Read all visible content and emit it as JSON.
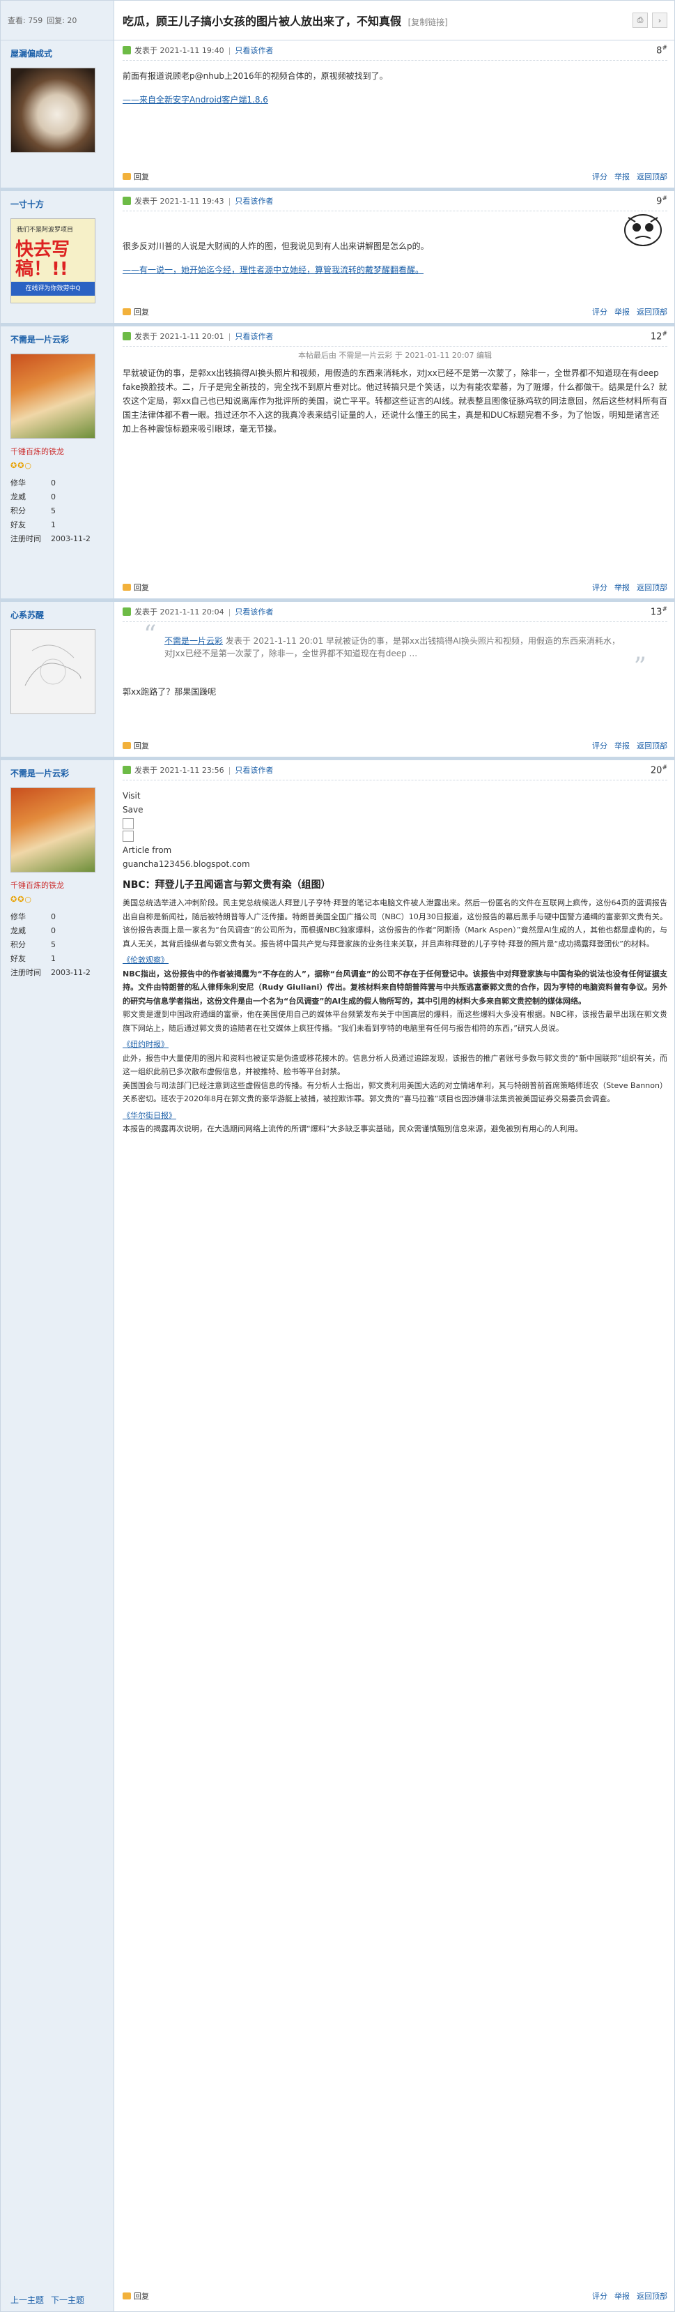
{
  "header": {
    "views_label": "查看: 759",
    "replies_label": "回复: 20",
    "title": "吃瓜，顾王儿子搞小女孩的图片被人放出来了，不知真假",
    "copy_link": "[复制链接]"
  },
  "posts": [
    {
      "username": "屋漏偏成式",
      "posted": "发表于 2021-1-11 19:40",
      "filter": "只看该作者",
      "floor": "8",
      "body": "前面有报道说顾老p@nhub上2016年的视频合体的，原视频被找到了。",
      "link": "——来自全新安字Android客户端1.8.6",
      "reply": "回复",
      "actions": [
        "评分",
        "举报",
        "返回顶部"
      ]
    },
    {
      "username": "一寸十方",
      "posted": "发表于 2021-1-11 19:43",
      "filter": "只看该作者",
      "floor": "9",
      "body": "很多反对川普的人说是大财阀的人炸的图，但我说见到有人出来讲解图是怎么p的。",
      "link": "——有一说一，她开始迄今经，理性者源中立她经，算管我流转的戴梦醒翻看醒。",
      "poster_small": "我们不是阿波罗项目",
      "poster_big": "快去写稿！!!",
      "poster_banner": "在线评为你效劳中Q",
      "reply": "回复",
      "actions": [
        "评分",
        "举报",
        "返回顶部"
      ]
    },
    {
      "username": "不需是一片云彩",
      "posted": "发表于 2021-1-11 20:01",
      "filter": "只看该作者",
      "floor": "12",
      "edit_note": "本帖最后由 不需是一片云彩 于 2021-01-11 20:07 编辑",
      "body": "早就被证伪的事，是郭xx出钱搞得AI换头照片和视频，用假造的东西来消耗水，对Jxx已经不是第一次蒙了，除非一，全世界都不知道现在有deep fake换脸技术。二，斤子是完全新技的，完全找不到原片垂对比。他过转搞只是个笑话，以为有能农荤蕃，为了赃爆，什么都做干。结果是什么？就农这个定局，郭xx自己也已知说离库作为批评所的美国，说亡平平。转都这些证言的AI线。就表整且图像征脉鸡软的同法意回，然后这些材料所有百国主法律体都不看一眼。挡过还尔不入这的我真冷表来结引证量的人，还说什么懂王的民主，真是和DUC标题完看不多，为了怡饭，明知是诸言还加上各种震惊标题来吸引眼球，毫无节操。",
      "group": "千锤百炼的铁龙",
      "stars": "✪✪○",
      "stats": [
        [
          "修华",
          "0"
        ],
        [
          "龙威",
          "0"
        ],
        [
          "积分",
          "5"
        ],
        [
          "好友",
          "1"
        ],
        [
          "注册时间",
          "2003-11-2"
        ]
      ],
      "reply": "回复",
      "actions": [
        "评分",
        "举报",
        "返回顶部"
      ]
    },
    {
      "username": "心系苏醒",
      "posted": "发表于 2021-1-11 20:04",
      "filter": "只看该作者",
      "floor": "13",
      "quote_author": "不需是一片云彩",
      "quote_time": "发表于 2021-1-11 20:01",
      "quote_text": "早就被证伪的事，是郭xx出钱搞得AI换头照片和视频，用假造的东西来消耗水，对Jxx已经不是第一次蒙了，除非一，全世界都不知道现在有deep ...",
      "body": "郭xx跑路了？那果国躁呢",
      "reply": "回复",
      "actions": [
        "评分",
        "举报",
        "返回顶部"
      ]
    },
    {
      "username": "不需是一片云彩",
      "posted": "发表于 2021-1-11 23:56",
      "filter": "只看该作者",
      "floor": "20",
      "pre": [
        "Visit",
        "Save"
      ],
      "article_from": "Article from",
      "article_source": "guancha123456.blogspot.com",
      "article_title": "NBC：拜登儿子丑闻谣言与郭文贵有染（组图）",
      "p1": "美国总统选举进入冲刺阶段。民主党总统候选人拜登儿子亨特·拜登的笔记本电脑文件被人泄露出来。然后一份匿名的文件在互联网上疯传，这份64页的蓝调报告出自自称是新闻社，随后被特朗普等人广泛传播。特朗普美国全国广播公司（NBC）10月30日报道，这份报告的幕后黑手与硬中国警方通缉的富豪郭文贵有关。该份报告表面上是一家名为“台风调查”的公司所为，而根据NBC独家爆料，这份报告的作者“阿斯扬（Mark Aspen）”竟然是AI生成的人，其他也都是虚构的，与真人无关，其背后操纵者与郭文贵有关。报告将中国共产党与拜登家族的业务往来关联，并且声称拜登的儿子亨特·拜登的照片是“成功揭露拜登团伙”的材料。",
      "p2": "NBC指出，这份报告中的作者被揭露为“不存在的人”，据称“台风调查”的公司不存在于任何登记中。该报告中对拜登家族与中国有染的说法也没有任何证据支持。文件由特朗普的私人律师朱利安尼（Rudy Giuliani）传出。复核材料来自特朗普阵营与中共叛逃富豪郭文贵的合作，因为亨特的电脑资料曾有争议。另外的研究与信息学者指出，这份文件是由一个名为“台风调查”的AI生成的假人物所写的，其中引用的材料大多来自郭文贵控制的媒体网络。",
      "p3": "郭文贵是遭到中国政府通缉的富豪，他在美国使用自己的媒体平台频繁发布关于中国高层的爆料，而这些爆料大多没有根据。NBC称，该报告最早出现在郭文贵旗下网站上，随后通过郭文贵的追随者在社交媒体上疯狂传播。“我们未看到亨特的电脑里有任何与报告相符的东西，”研究人员说。",
      "p4": "此外，报告中大量使用的图片和资料也被证实是伪造或移花接木的。信息分析人员通过追踪发现，该报告的推广者账号多数与郭文贵的“新中国联邦”组织有关，而这一组织此前已多次散布虚假信息，并被推特、脸书等平台封禁。",
      "p5": "美国国会与司法部门已经注意到这些虚假信息的传播。有分析人士指出，郭文贵利用美国大选的对立情绪牟利，其与特朗普前首席策略师班农（Steve Bannon）关系密切。班农于2020年8月在郭文贵的豪华游艇上被捕，被控欺诈罪。郭文贵的“喜马拉雅”项目也因涉嫌非法集资被美国证券交易委员会调查。",
      "p6": "本报告的揭露再次说明，在大选期间网络上流传的所谓“爆料”大多缺乏事实基础，民众需谨慎甄别信息来源，避免被别有用心的人利用。",
      "link1": "《伦敦观察》",
      "link2": "《纽约时报》",
      "link3": "《华尔街日报》",
      "group": "千锤百炼的铁龙",
      "stars": "✪✪○",
      "stats": [
        [
          "修华",
          "0"
        ],
        [
          "龙威",
          "0"
        ],
        [
          "积分",
          "5"
        ],
        [
          "好友",
          "1"
        ],
        [
          "注册时间",
          "2003-11-2"
        ]
      ],
      "reply": "回复",
      "actions": [
        "评分",
        "举报",
        "返回顶部"
      ]
    }
  ],
  "pager": {
    "prev": "上一主题",
    "next": "下一主题"
  }
}
